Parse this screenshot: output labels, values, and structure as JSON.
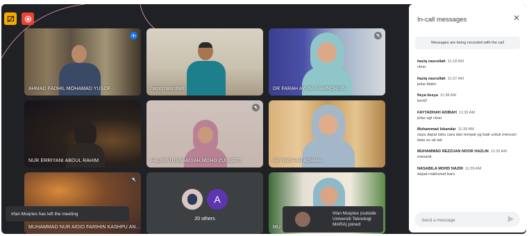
{
  "top_icons": [
    "present-icon",
    "record-icon"
  ],
  "tiles": [
    {
      "id": "ahmad",
      "name": "AHMAD FADHIL MOHAMAD YUSOF",
      "active": true
    },
    {
      "id": "haziq",
      "name": "haziq nasrullah"
    },
    {
      "id": "farah",
      "name": "DR FARAH AYUNI FARINORDIN"
    },
    {
      "id": "erriyani",
      "name": "NUR ERRIYANI ABDUL RAHIM"
    },
    {
      "id": "halimatus",
      "name": "HALIMATUSSAADIAH MOHD ZULKEFLI"
    },
    {
      "id": "fayyadhah",
      "name": "FAYYADHAH ADIBAH"
    },
    {
      "id": "aidid",
      "name": "MUHAMMAD NUR AIDID FARIHIN KASHPU AN..."
    },
    {
      "id": "others",
      "name": "20 others",
      "avatar_letter": "A"
    },
    {
      "id": "mu",
      "name": "MU"
    }
  ],
  "toasts": {
    "left": "Irfan Muqries has left the meeting",
    "right": "Irfan Muqries (outside Universiti Teknologi MARA) joined"
  },
  "panel": {
    "title": "In-call messages",
    "notice": "Messages are being recorded with the call",
    "messages": [
      {
        "sender": "haziq nasrullah",
        "time": "11:18 AM",
        "text": "clear"
      },
      {
        "sender": "haziq nasrullah",
        "time": "11:37 AM",
        "text": "jelas blako"
      },
      {
        "sender": "fieya liesya",
        "time": "11:38 AM",
        "text": "best2"
      },
      {
        "sender": "FAYYADHAH ADIBAH",
        "time": "11:39 AM",
        "text": "jelas sgt clear"
      },
      {
        "sender": "Muhammad Iskandar",
        "time": "11:39 AM",
        "text": "saya dapat tahu cara dan tempat yg baik untuk mencari data so ok lah"
      },
      {
        "sender": "MUHAMMAD REZZUAN NOOR HAZLIN",
        "time": "11:39 AM",
        "text": "menarik"
      },
      {
        "sender": "NASABILA MOHD NAZRI",
        "time": "11:39 AM",
        "text": "dapat maklumat baru"
      }
    ],
    "send_placeholder": "Send a message"
  },
  "colors": {
    "meet_bg": "#202124",
    "tile_bg": "#3c4043",
    "accent": "#8ab4f8",
    "record": "#ea4335",
    "present": "#f9ab00"
  }
}
